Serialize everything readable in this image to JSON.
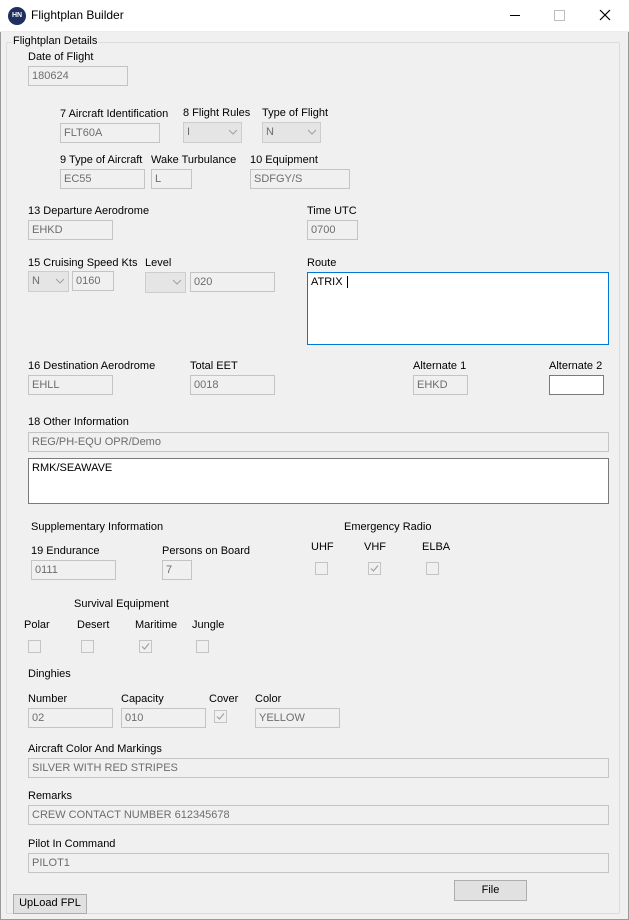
{
  "window": {
    "title": "Flightplan Builder",
    "logo_text": "HN"
  },
  "details": {
    "group_label": "Flightplan Details",
    "date_label": "Date of Flight",
    "date_value": "180624",
    "aircraft_id_label": "7 Aircraft Identification",
    "aircraft_id_value": "FLT60A",
    "flight_rules_label": "8 Flight Rules",
    "flight_rules_value": "I",
    "type_of_flight_label": "Type of Flight",
    "type_of_flight_value": "N",
    "aircraft_type_label": "9 Type of Aircraft",
    "aircraft_type_value": "EC55",
    "wake_label": "Wake Turbulance",
    "wake_value": "L",
    "equipment_label": "10 Equipment",
    "equipment_value": "SDFGY/S",
    "departure_label": "13 Departure Aerodrome",
    "departure_value": "EHKD",
    "time_label": "Time UTC",
    "time_value": "0700",
    "speed_label": "15 Cruising Speed Kts",
    "speed_unit_value": "N",
    "speed_value": "0160",
    "level_label": "Level",
    "level_unit_value": "",
    "level_value": "020",
    "route_label": "Route",
    "route_value": "ATRIX ",
    "destination_label": "16 Destination Aerodrome",
    "destination_value": "EHLL",
    "eet_label": "Total EET",
    "eet_value": "0018",
    "alt1_label": "Alternate 1",
    "alt1_value": "EHKD",
    "alt2_label": "Alternate 2",
    "alt2_value": "",
    "other_info_label": "18 Other Information",
    "other_info_value": "REG/PH-EQU OPR/Demo",
    "other_info_text": "RMK/SEAWAVE"
  },
  "supplementary": {
    "label": "Supplementary Information",
    "endurance_label": "19 Endurance",
    "endurance_value": "0111",
    "pob_label": "Persons on Board",
    "pob_value": "7",
    "radio_label": "Emergency Radio",
    "uhf_label": "UHF",
    "uhf_checked": false,
    "vhf_label": "VHF",
    "vhf_checked": true,
    "elba_label": "ELBA",
    "elba_checked": false,
    "survival_label": "Survival Equipment",
    "polar_label": "Polar",
    "polar_checked": false,
    "desert_label": "Desert",
    "desert_checked": false,
    "maritime_label": "Maritime",
    "maritime_checked": true,
    "jungle_label": "Jungle",
    "jungle_checked": false,
    "dinghies_label": "Dinghies",
    "number_label": "Number",
    "number_value": "02",
    "capacity_label": "Capacity",
    "capacity_value": "010",
    "cover_label": "Cover",
    "cover_checked": true,
    "color_label": "Color",
    "color_value": "YELLOW",
    "markings_label": "Aircraft Color And Markings",
    "markings_value": "SILVER WITH RED STRIPES",
    "remarks_label": "Remarks",
    "remarks_value": "CREW CONTACT NUMBER 612345678",
    "pic_label": "Pilot In Command",
    "pic_value": "PILOT1"
  },
  "buttons": {
    "file_label": "File",
    "upload_label": "UpLoad FPL"
  },
  "colors": {
    "logo_bg": "#1f2f5e",
    "window_bg": "#f0f0f0",
    "disabled_text": "#6d6d6d"
  }
}
